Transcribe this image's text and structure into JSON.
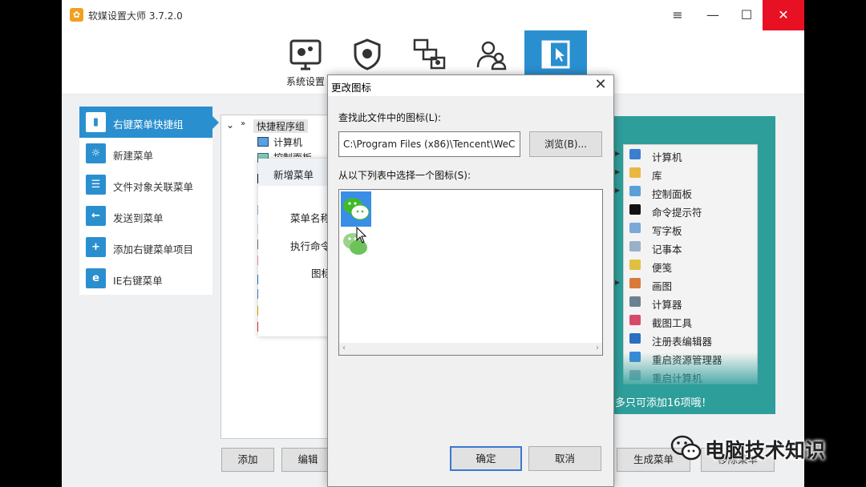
{
  "app": {
    "title": "软媒设置大师 3.7.2.0",
    "window_controls": {
      "menu": "≡",
      "minimize": "—",
      "maximize": "☐",
      "close": "✕"
    }
  },
  "toolbar": {
    "items": [
      {
        "label": "系统设置",
        "icon": "system-settings-icon"
      },
      {
        "label": "",
        "icon": "security-shield-icon"
      },
      {
        "label": "",
        "icon": "network-devices-icon"
      },
      {
        "label": "",
        "icon": "users-icon"
      },
      {
        "label": "",
        "icon": "context-menu-icon",
        "active": true
      }
    ]
  },
  "sidebar": {
    "items": [
      {
        "label": "右键菜单快捷组",
        "active": true
      },
      {
        "label": "新建菜单"
      },
      {
        "label": "文件对象关联菜单"
      },
      {
        "label": "发送到菜单"
      },
      {
        "label": "添加右键菜单项目"
      },
      {
        "label": "IE右键菜单"
      }
    ]
  },
  "tree": {
    "root": "快捷程序组",
    "items": [
      "计算机",
      "控制面板"
    ]
  },
  "new_menu_dialog": {
    "title": "新增菜单",
    "fields": [
      "菜单名称",
      "执行命令",
      "图标"
    ]
  },
  "preview_menu": {
    "items": [
      "计算机",
      "库",
      "控制面板",
      "命令提示符",
      "写字板",
      "记事本",
      "便笺",
      "画图",
      "计算器",
      "截图工具",
      "注册表编辑器",
      "重启资源管理器",
      "重启计算机"
    ],
    "note": "多只可添加16项哦！"
  },
  "bottom_buttons": {
    "add": "添加",
    "edit": "编辑",
    "generate": "生成菜单",
    "remove": "移除菜单"
  },
  "change_icon_dialog": {
    "title": "更改图标",
    "close": "✕",
    "find_label": "查找此文件中的图标(L):",
    "path_value": "C:\\Program Files (x86)\\Tencent\\WeC",
    "browse_label": "浏览(B)...",
    "list_label": "从以下列表中选择一个图标(S):",
    "ok_label": "确定",
    "cancel_label": "取消"
  },
  "watermark": {
    "text": "电脑技术知识"
  },
  "colors": {
    "accent": "#2a8fcf",
    "teal": "#2e9e9b",
    "close_red": "#e81123",
    "wechat_green": "#3dbb2b"
  }
}
